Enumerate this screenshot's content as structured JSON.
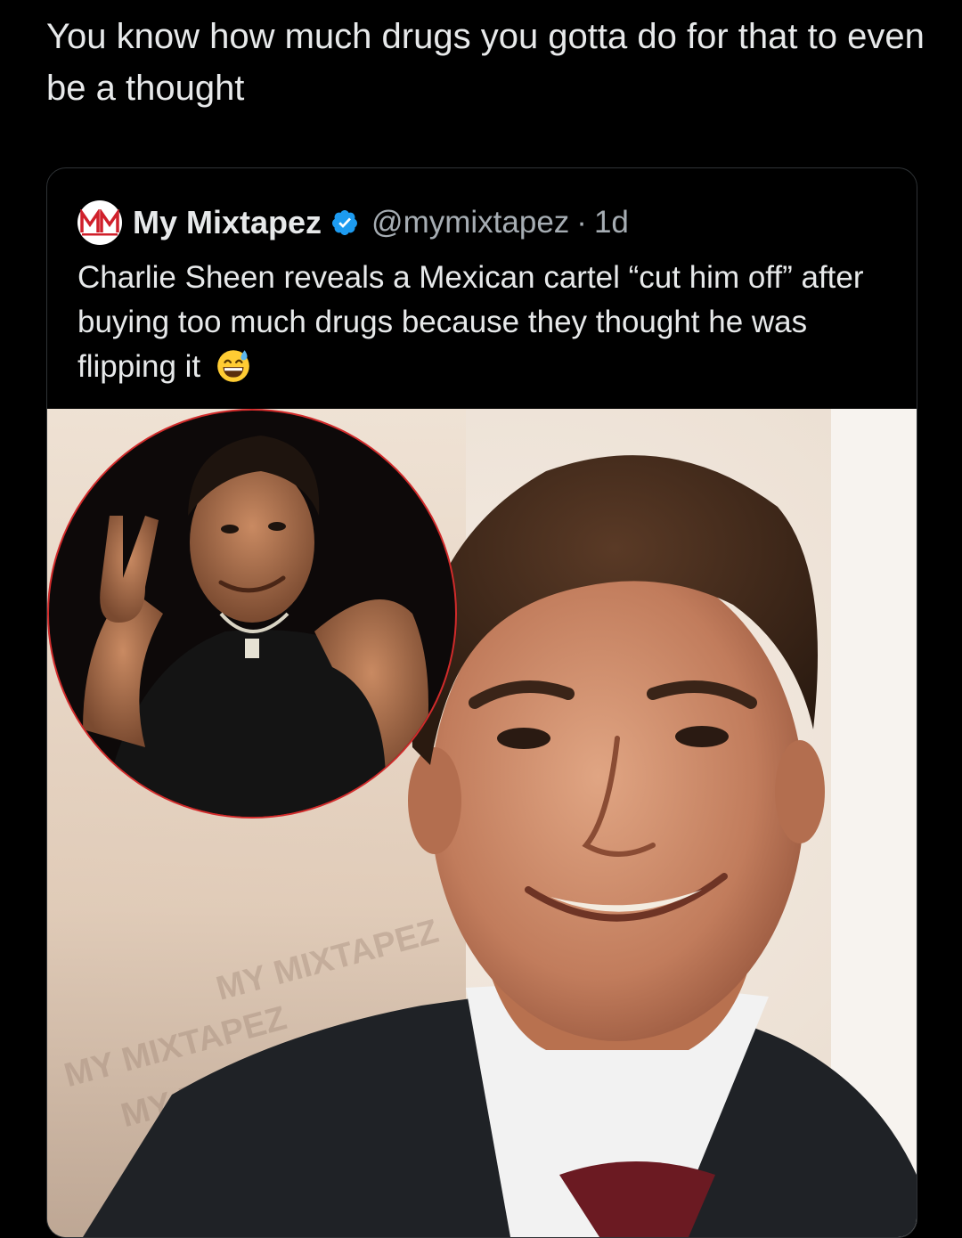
{
  "post": {
    "text": "You know how much drugs you gotta do for that to even be a thought"
  },
  "quoted_post": {
    "author_name": "My Mixtapez",
    "handle": "@mymixtapez",
    "separator": "·",
    "time": "1d",
    "text": "Charlie Sheen reveals a Mexican cartel “cut him off” after buying too much drugs because they thought he was flipping it",
    "emoji_icon": "grinning-face-with-sweat-icon",
    "avatar_icon": "mymixtapez-logo-icon",
    "verified_icon": "verified-badge-icon",
    "media": {
      "watermark_text": "MY MIXTAPEZ"
    }
  },
  "colors": {
    "background": "#000000",
    "text": "#e7e9ea",
    "muted": "#a6adb3",
    "border": "#2f3336",
    "verified": "#1d9bf0",
    "brand_red": "#d0202b"
  }
}
